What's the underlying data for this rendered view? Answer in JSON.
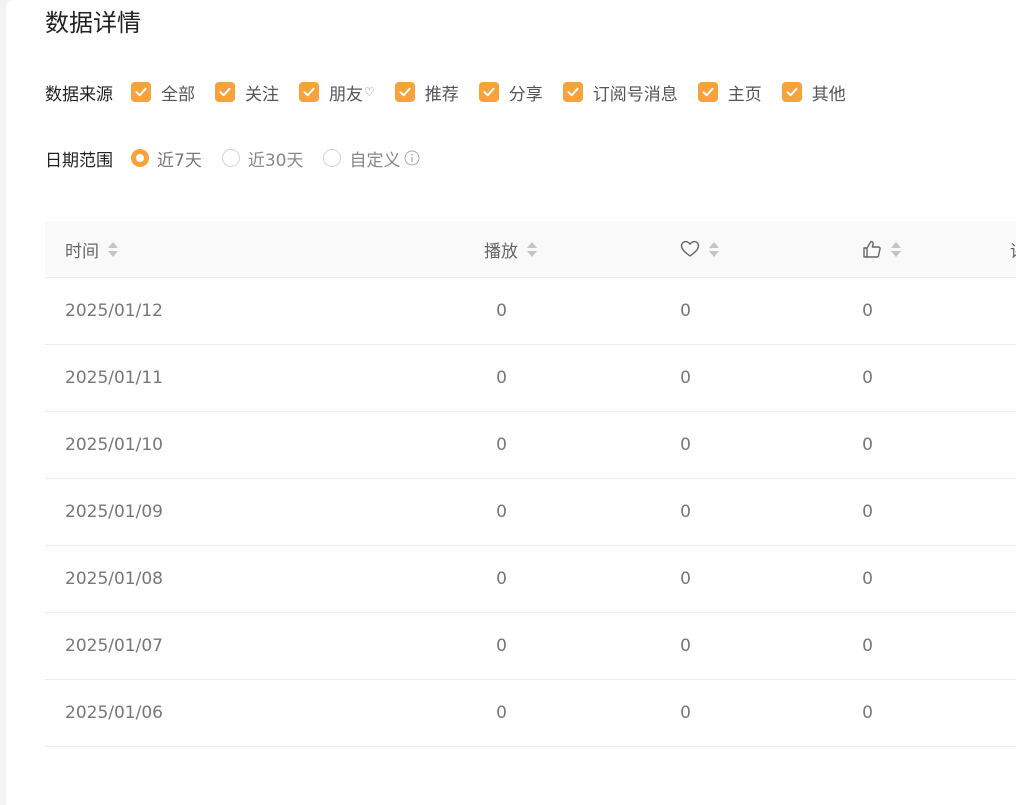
{
  "page": {
    "title": "数据详情"
  },
  "filters": {
    "source_label": "数据来源",
    "sources": [
      {
        "label": "全部",
        "checked": true
      },
      {
        "label": "关注",
        "checked": true
      },
      {
        "label": "朋友",
        "checked": true
      },
      {
        "label": "推荐",
        "checked": true
      },
      {
        "label": "分享",
        "checked": true
      },
      {
        "label": "订阅号消息",
        "checked": true
      },
      {
        "label": "主页",
        "checked": true
      },
      {
        "label": "其他",
        "checked": true
      }
    ],
    "date_label": "日期范围",
    "dates": [
      {
        "label": "近7天",
        "selected": true
      },
      {
        "label": "近30天",
        "selected": false
      },
      {
        "label": "自定义",
        "selected": false
      }
    ]
  },
  "table": {
    "columns": {
      "time": "时间",
      "play": "播放",
      "like_icon": "heart-icon",
      "thumb_icon": "thumbs-up-icon",
      "comment": "评"
    },
    "rows": [
      {
        "date": "2025/01/12",
        "play": "0",
        "like": "0",
        "thumb": "0"
      },
      {
        "date": "2025/01/11",
        "play": "0",
        "like": "0",
        "thumb": "0"
      },
      {
        "date": "2025/01/10",
        "play": "0",
        "like": "0",
        "thumb": "0"
      },
      {
        "date": "2025/01/09",
        "play": "0",
        "like": "0",
        "thumb": "0"
      },
      {
        "date": "2025/01/08",
        "play": "0",
        "like": "0",
        "thumb": "0"
      },
      {
        "date": "2025/01/07",
        "play": "0",
        "like": "0",
        "thumb": "0"
      },
      {
        "date": "2025/01/06",
        "play": "0",
        "like": "0",
        "thumb": "0"
      }
    ]
  },
  "colors": {
    "accent": "#f7a23a",
    "border": "#ececec",
    "header_bg": "#f9f9f9"
  }
}
